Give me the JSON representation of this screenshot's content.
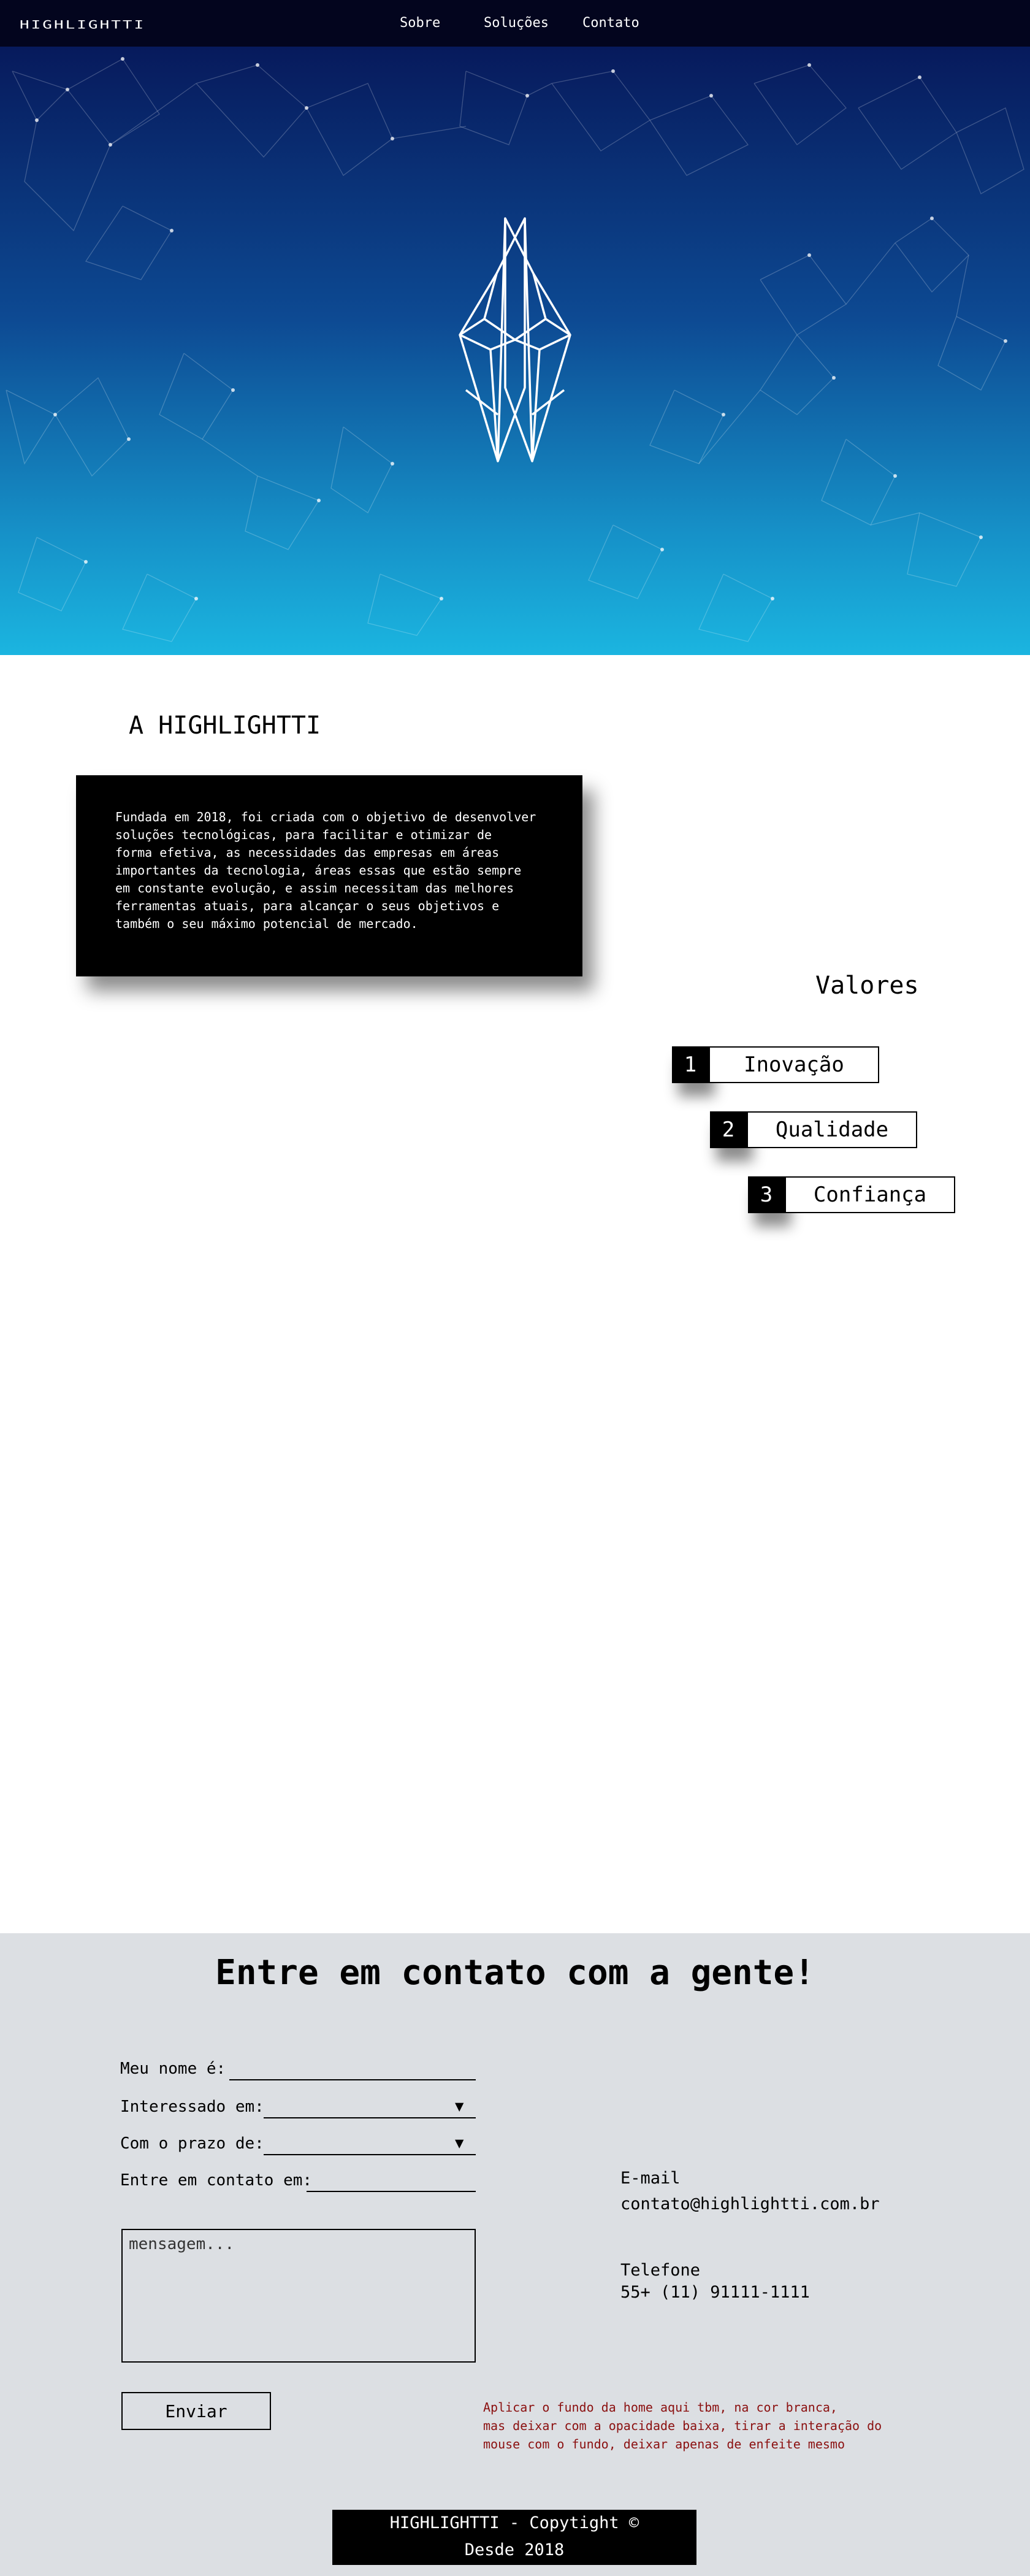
{
  "nav": {
    "logo": "HIGHLIGHTTI",
    "links": [
      "Sobre",
      "Soluções",
      "Contato"
    ]
  },
  "hero": {
    "logo_icon": "crystal-gem-icon",
    "gradient_top": "#071a5c",
    "gradient_bottom": "#1bb5e0"
  },
  "about": {
    "title": "A HIGHLIGHTTI",
    "lines": [
      "Fundada em 2018, foi criada com o objetivo de desenvolver",
      "soluções tecnológicas, para facilitar e otimizar de",
      "forma efetiva, as necessidades das empresas em áreas",
      "importantes da tecnologia, áreas essas que estão sempre",
      "em constante evolução, e assim necessitam das melhores",
      "ferramentas atuais, para alcançar o seus objetivos e",
      "também o seu máximo potencial de mercado."
    ]
  },
  "values": {
    "title": "Valores",
    "items": [
      {
        "num": "1",
        "label": "Inovação"
      },
      {
        "num": "2",
        "label": "Qualidade"
      },
      {
        "num": "3",
        "label": "Confiança"
      }
    ]
  },
  "contact": {
    "title": "Entre em contato com a gente!",
    "name_label": "Meu nome é:",
    "interest_label": "Interessado em:",
    "deadline_label": "Com o prazo de:",
    "contact_label": "Entre em contato em:",
    "message_placeholder": "mensagem...",
    "send_label": "Enviar",
    "email_title": "E-mail",
    "email_value": "contato@highlightti.com.br",
    "phone_title": "Telefone",
    "phone_value": "55+ (11) 91111-1111",
    "note_lines": [
      "Aplicar o fundo da home aqui tbm, na cor branca,",
      "mas deixar com a opacidade baixa, tirar a interação do",
      "mouse com o fundo, deixar apenas de enfeite mesmo"
    ]
  },
  "footer": {
    "line1": "HIGHLIGHTTI - Copytight ©",
    "line2": "Desde 2018"
  }
}
